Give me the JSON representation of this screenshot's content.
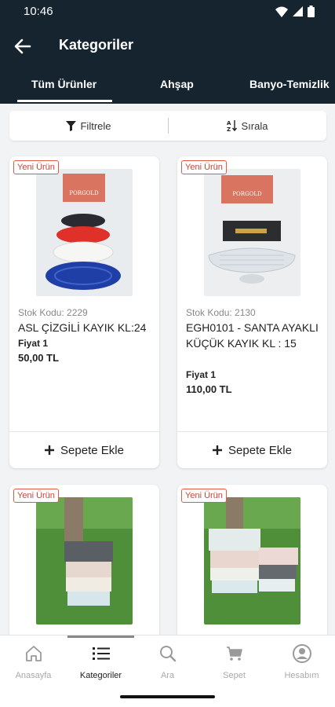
{
  "status_bar": {
    "time": "10:46"
  },
  "app_bar": {
    "title": "Kategoriler"
  },
  "tabs": [
    {
      "label": "Tüm Ürünler",
      "active": true
    },
    {
      "label": "Ahşap"
    },
    {
      "label": "Banyo-Temizlik"
    }
  ],
  "filter_bar": {
    "filter_label": "Filtrele",
    "sort_label": "Sırala"
  },
  "products": [
    {
      "badge": "Yeni Ürün",
      "stock_code": "Stok Kodu: 2229",
      "name": "ASL ÇİZGİLİ KAYIK KL:24",
      "price_label": "Fiyat 1",
      "price": "50,00 TL",
      "add_label": "Sepete Ekle",
      "box_brand": "PORGOLD"
    },
    {
      "badge": "Yeni Ürün",
      "stock_code": "Stok Kodu: 2130",
      "name": "EGH0101 - SANTA AYAKLI KÜÇÜK KAYIK KL : 15",
      "price_label": "Fiyat 1",
      "price": "110,00 TL",
      "add_label": "Sepete Ekle",
      "box_brand": "PORGOLD"
    },
    {
      "badge": "Yeni Ürün"
    },
    {
      "badge": "Yeni Ürün"
    }
  ],
  "bottom_nav": [
    {
      "label": "Anasayfa",
      "icon": "home-icon"
    },
    {
      "label": "Kategoriler",
      "icon": "list-icon",
      "active": true
    },
    {
      "label": "Ara",
      "icon": "search-icon"
    },
    {
      "label": "Sepet",
      "icon": "cart-icon"
    },
    {
      "label": "Hesabım",
      "icon": "account-icon"
    }
  ],
  "colors": {
    "header": "#15242f",
    "badge_red": "#d34334",
    "background": "#f2f3f5"
  }
}
